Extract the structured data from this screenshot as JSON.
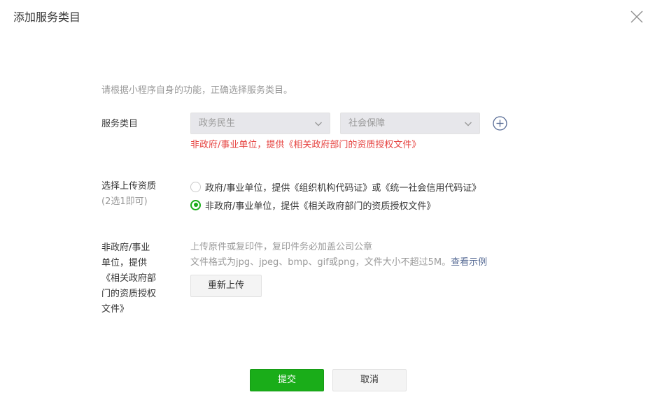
{
  "dialog": {
    "title": "添加服务类目",
    "intro": "请根据小程序自身的功能，正确选择服务类目。"
  },
  "category": {
    "label": "服务类目",
    "primary_select": "政务民生",
    "secondary_select": "社会保障",
    "error": "非政府/事业单位，提供《相关政府部门的资质授权文件》"
  },
  "qualification": {
    "label": "选择上传资质",
    "sublabel": "(2选1即可)",
    "options": [
      {
        "label": "政府/事业单位，提供《组织机构代码证》或《统一社会信用代码证》",
        "checked": false
      },
      {
        "label": "非政府/事业单位，提供《相关政府部门的资质授权文件》",
        "checked": true
      }
    ]
  },
  "upload": {
    "label_lines": [
      "非政府/事业",
      "单位，提供",
      "《相关政府部",
      "门的资质授权",
      "文件》"
    ],
    "hint1": "上传原件或复印件，复印件务必加盖公司公章",
    "hint2": "文件格式为jpg、jpeg、bmp、gif或png，文件大小不超过5M。",
    "example_link": "查看示例",
    "reupload_button": "重新上传"
  },
  "footer": {
    "submit": "提交",
    "cancel": "取消"
  },
  "colors": {
    "accent_green": "#1aad19",
    "error_red": "#e64340",
    "link_blue": "#576b95"
  },
  "icons": [
    "close-icon",
    "chevron-down-icon",
    "plus-circle-icon"
  ]
}
